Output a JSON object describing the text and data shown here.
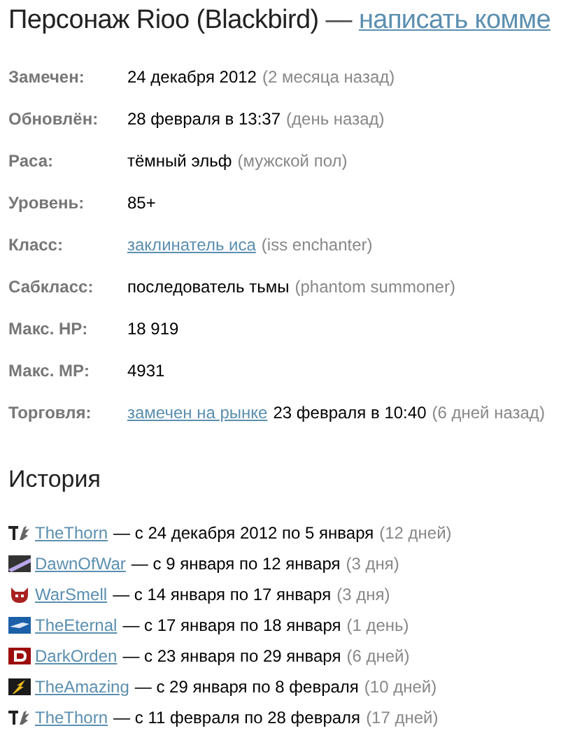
{
  "title": {
    "text": "Персонаж Rioo (Blackbird)",
    "separator": "—",
    "link": "написать комме"
  },
  "info": [
    {
      "label": "Замечен:",
      "value": "24 декабря 2012",
      "note": "(2 месяца назад)"
    },
    {
      "label": "Обновлён:",
      "value": "28 февраля в 13:37",
      "note": "(день назад)"
    },
    {
      "label": "Раса:",
      "value": "тёмный эльф",
      "note": "(мужской пол)"
    },
    {
      "label": "Уровень:",
      "value": "85+"
    },
    {
      "label": "Класс:",
      "link": "заклинатель иса",
      "note": "(iss enchanter)"
    },
    {
      "label": "Сабкласс:",
      "value": "последователь тьмы",
      "note": "(phantom summoner)"
    },
    {
      "label": "Макс. HP:",
      "value": "18 919"
    },
    {
      "label": "Макс. MP:",
      "value": "4931"
    },
    {
      "label": "Торговля:",
      "link": "замечен на рынке",
      "value": "23 февраля в 10:40",
      "note": "(6 дней назад)"
    }
  ],
  "history": {
    "heading": "История",
    "items": [
      {
        "kind": "thorn",
        "clan": "TheThorn",
        "period": "— с 24 декабря 2012 по 5 января",
        "duration": "(12 дней)"
      },
      {
        "kind": "streak",
        "clan": "DawnOfWar",
        "period": "— с 9 января по 12 января",
        "duration": "(3 дня)"
      },
      {
        "kind": "devil",
        "clan": "WarSmell",
        "period": "— с 14 января по 17 января",
        "duration": "(3 дня)"
      },
      {
        "kind": "sky",
        "clan": "TheEternal",
        "period": "— с 17 января по 18 января",
        "duration": "(1 день)"
      },
      {
        "kind": "letter",
        "clan": "DarkOrden",
        "period": "— с 23 января по 29 января",
        "duration": "(6 дней)"
      },
      {
        "kind": "bolt",
        "clan": "TheAmazing",
        "period": "— с 29 января по 8 февраля",
        "duration": "(10 дней)"
      },
      {
        "kind": "thorn",
        "clan": "TheThorn",
        "period": "— с 11 февраля по 28 февраля",
        "duration": "(17 дней)"
      }
    ]
  }
}
